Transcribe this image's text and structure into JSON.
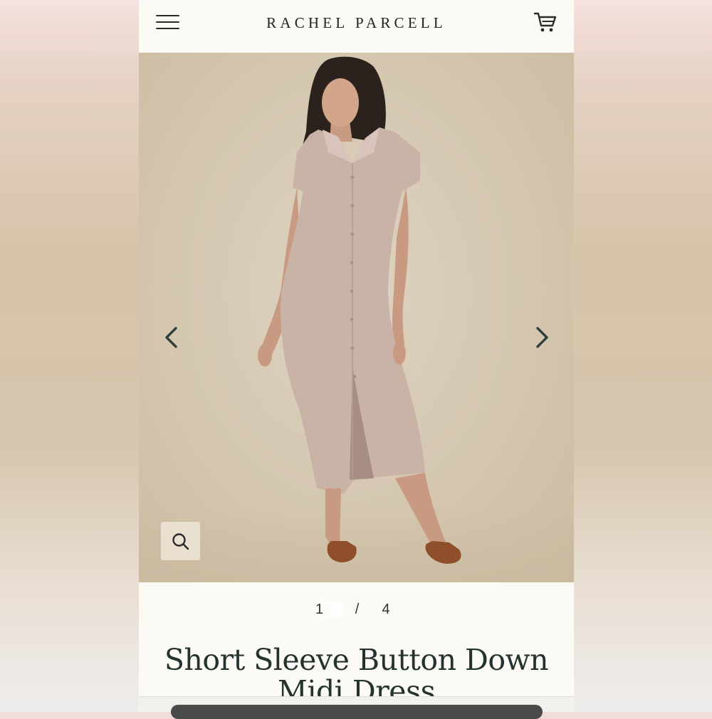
{
  "header": {
    "brand": "RACHEL PARCELL",
    "menu_icon": "hamburger-menu-icon",
    "cart_icon": "shopping-cart-icon"
  },
  "gallery": {
    "current": "1",
    "separator": "/",
    "total": "4",
    "prev_icon": "chevron-left-icon",
    "next_icon": "chevron-right-icon",
    "zoom_icon": "search-icon"
  },
  "product": {
    "title": "Short Sleeve Button Down Midi Dress"
  },
  "colors": {
    "page_bg": "#fcfaf5",
    "text_dark": "#243330",
    "dress": "#c9b2a6",
    "backdrop": "#d6c9b3"
  }
}
